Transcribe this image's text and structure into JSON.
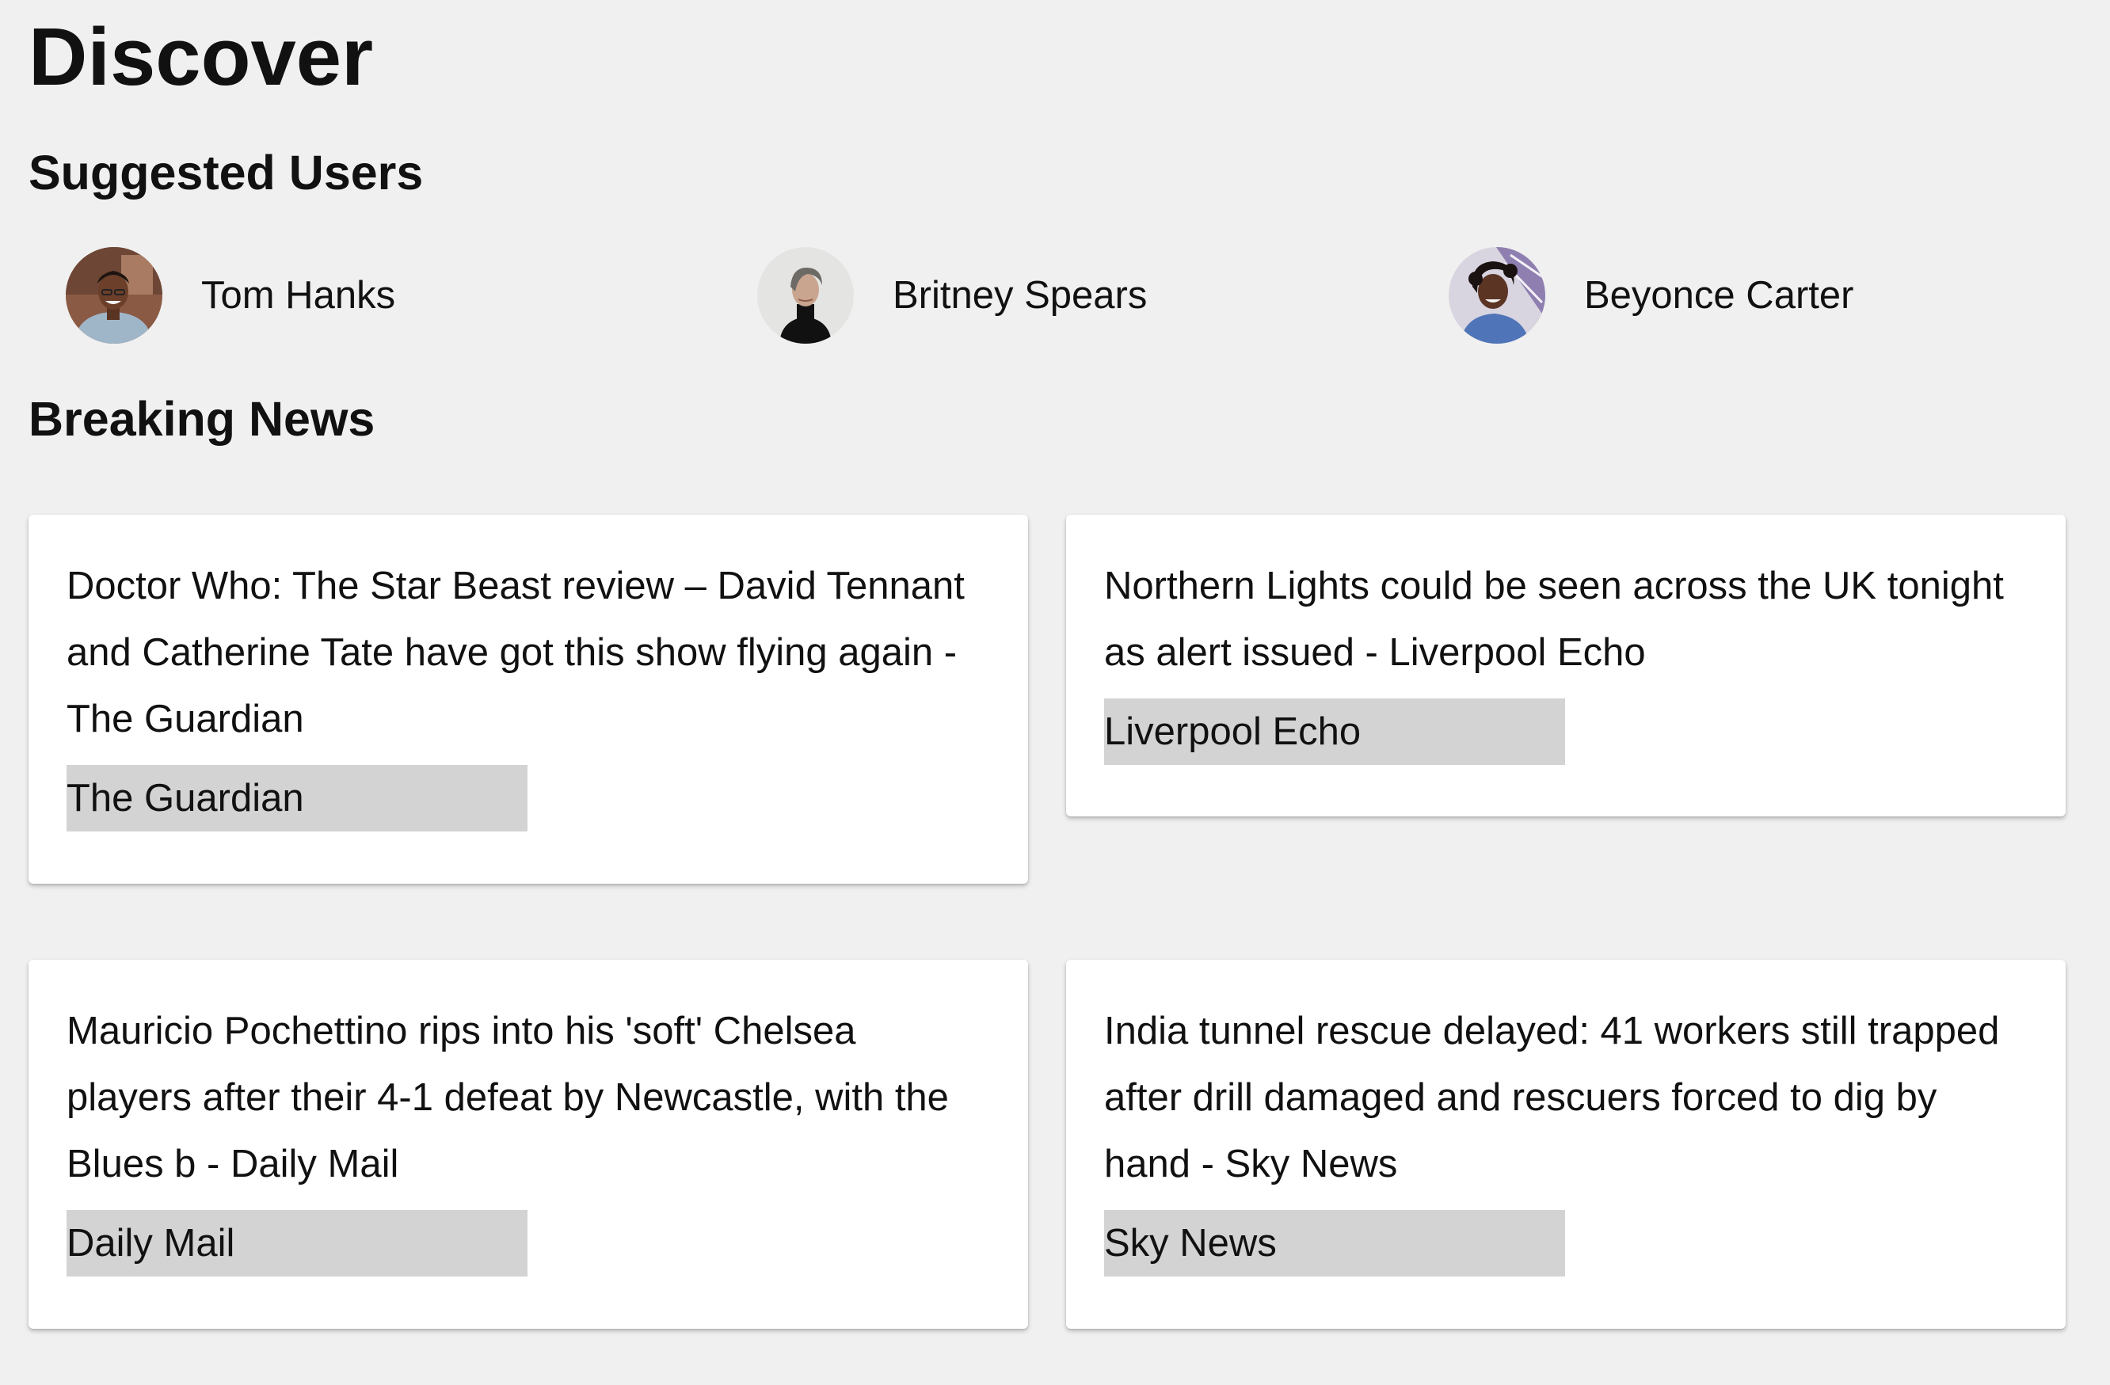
{
  "page": {
    "title": "Discover"
  },
  "suggested_users": {
    "heading": "Suggested Users",
    "users": [
      {
        "name": "Tom Hanks",
        "avatar_icon": "user-avatar-photo"
      },
      {
        "name": "Britney Spears",
        "avatar_icon": "user-avatar-photo"
      },
      {
        "name": "Beyonce Carter",
        "avatar_icon": "user-avatar-photo"
      }
    ]
  },
  "breaking_news": {
    "heading": "Breaking News",
    "articles": [
      {
        "headline": "Doctor Who: The Star Beast review – David Tennant and Catherine Tate have got this show flying again - The Guardian",
        "source": "The Guardian"
      },
      {
        "headline": "Northern Lights could be seen across the UK tonight as alert issued - Liverpool Echo",
        "source": "Liverpool Echo"
      },
      {
        "headline": "Mauricio Pochettino rips into his 'soft' Chelsea players after their 4-1 defeat by Newcastle, with the Blues b - Daily Mail",
        "source": "Daily Mail"
      },
      {
        "headline": "India tunnel rescue delayed: 41 workers still trapped after drill damaged and rescuers forced to dig by hand - Sky News",
        "source": "Sky News"
      }
    ]
  },
  "colors": {
    "background": "#f0f0f0",
    "card": "#ffffff",
    "source_tag": "#d3d3d3",
    "text": "#111111"
  }
}
